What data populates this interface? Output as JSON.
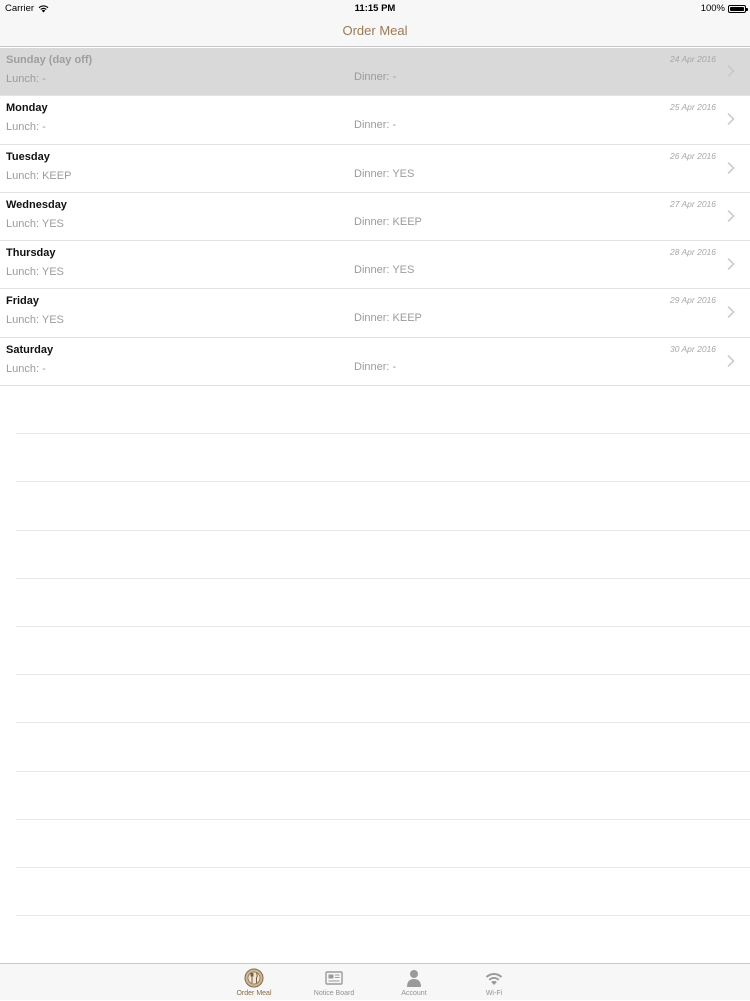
{
  "status_bar": {
    "carrier": "Carrier",
    "time": "11:15 PM",
    "battery": "100%"
  },
  "nav": {
    "title": "Order Meal"
  },
  "days": [
    {
      "day": "Sunday (day off)",
      "lunch": "Lunch: -",
      "dinner": "Dinner: -",
      "date": "24 Apr 2016",
      "selected": true
    },
    {
      "day": "Monday",
      "lunch": "Lunch: -",
      "dinner": "Dinner: -",
      "date": "25 Apr 2016"
    },
    {
      "day": "Tuesday",
      "lunch": "Lunch: KEEP",
      "dinner": "Dinner: YES",
      "date": "26 Apr 2016"
    },
    {
      "day": "Wednesday",
      "lunch": "Lunch: YES",
      "dinner": "Dinner: KEEP",
      "date": "27 Apr 2016"
    },
    {
      "day": "Thursday",
      "lunch": "Lunch: YES",
      "dinner": "Dinner: YES",
      "date": "28 Apr 2016"
    },
    {
      "day": "Friday",
      "lunch": "Lunch: YES",
      "dinner": "Dinner: KEEP",
      "date": "29 Apr 2016"
    },
    {
      "day": "Saturday",
      "lunch": "Lunch: -",
      "dinner": "Dinner: -",
      "date": "30 Apr 2016"
    }
  ],
  "tabs": [
    {
      "label": "Order Meal",
      "icon": "meal-icon",
      "active": true
    },
    {
      "label": "Notice Board",
      "icon": "notice-board-icon"
    },
    {
      "label": "Account",
      "icon": "account-icon"
    },
    {
      "label": "Wi-Fi",
      "icon": "wifi-icon"
    }
  ],
  "colors": {
    "accent": "#9a7a55",
    "selected_row": "#d9d9d9"
  }
}
